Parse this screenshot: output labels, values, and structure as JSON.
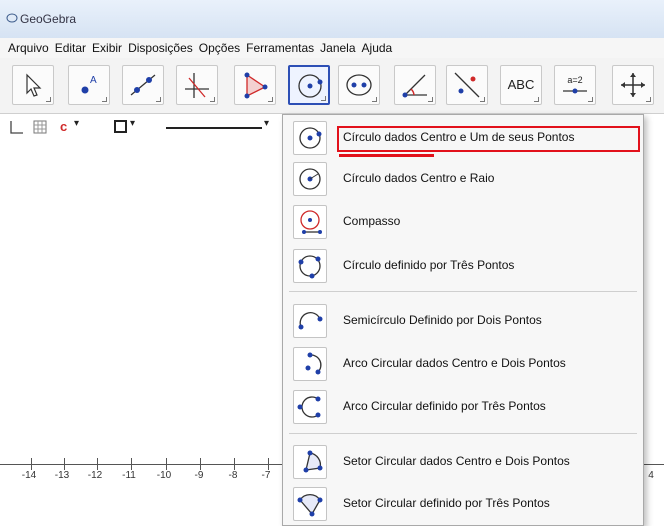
{
  "window": {
    "title": "GeoGebra"
  },
  "menu": [
    "Arquivo",
    "Editar",
    "Exibir",
    "Disposições",
    "Opções",
    "Ferramentas",
    "Janela",
    "Ajuda"
  ],
  "toolbar": {
    "text_tool_label": "ABC",
    "slider_tool_label": "a=2"
  },
  "stylebar": {
    "color_glyph": "c"
  },
  "axis": {
    "x_ticks": [
      "-14",
      "-13",
      "-12",
      "-11",
      "-10",
      "-9",
      "-8",
      "-7"
    ],
    "x_tick_partial": "4"
  },
  "dropdown": {
    "items": [
      {
        "label": "Círculo dados Centro e Um de seus Pontos",
        "icon": "circle-center-point-icon"
      },
      {
        "label": "Círculo dados Centro e Raio",
        "icon": "circle-center-radius-icon"
      },
      {
        "label": "Compasso",
        "icon": "compass-icon"
      },
      {
        "label": "Círculo definido por Três Pontos",
        "icon": "circle-three-points-icon"
      },
      {
        "label": "Semicírculo Definido por Dois Pontos",
        "icon": "semicircle-icon"
      },
      {
        "label": "Arco Circular dados Centro e Dois Pontos",
        "icon": "arc-center-icon"
      },
      {
        "label": "Arco Circular definido por Três Pontos",
        "icon": "arc-three-points-icon"
      },
      {
        "label": "Setor Circular dados Centro e Dois Pontos",
        "icon": "sector-center-icon"
      },
      {
        "label": "Setor Circular definido por Três Pontos",
        "icon": "sector-three-points-icon"
      }
    ]
  },
  "colors": {
    "accent_blue": "#2d4fb5",
    "highlight_red": "#e2111b",
    "point_blue": "#1f3fa8"
  }
}
